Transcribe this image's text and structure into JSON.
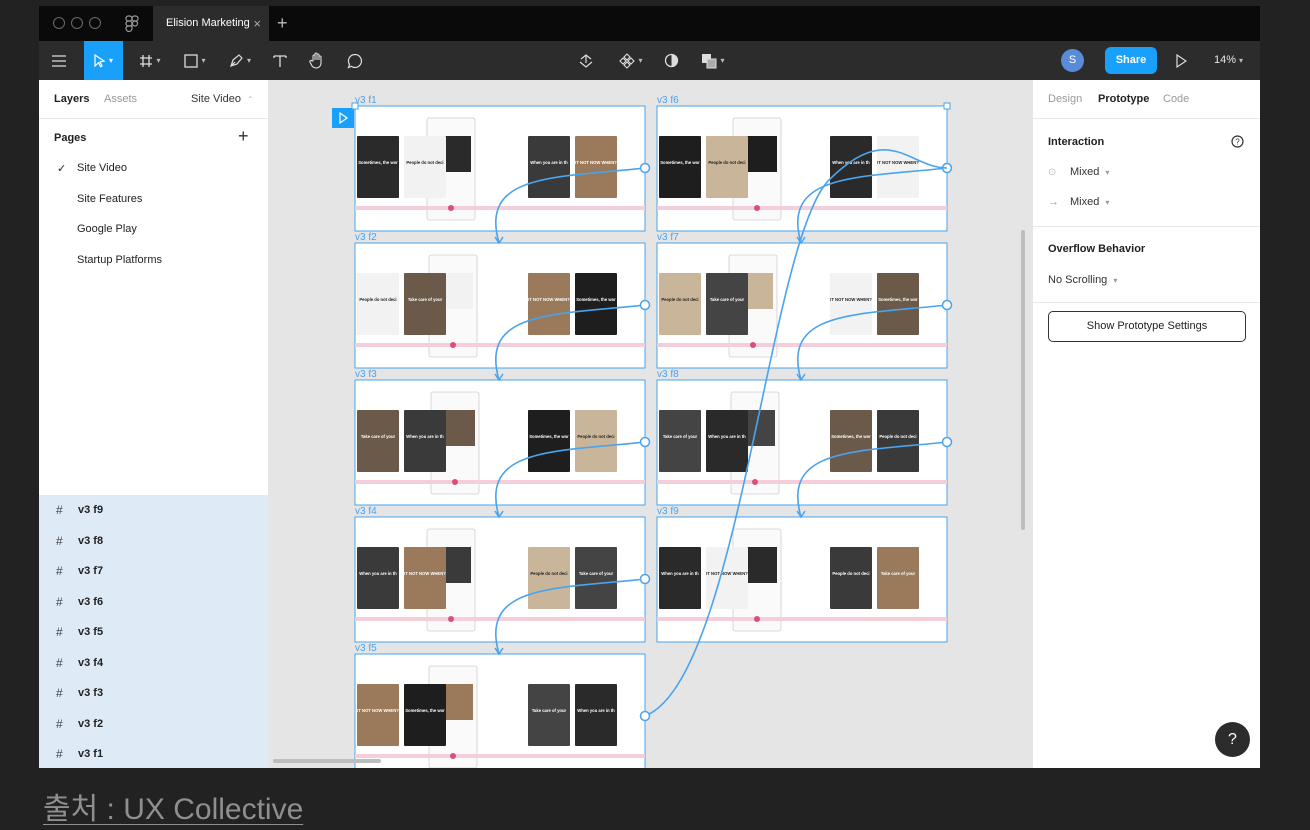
{
  "titlebar": {
    "tab_title": "Elision Marketing",
    "tab_close": "×",
    "new_tab": "+"
  },
  "toolbar": {
    "avatar_initial": "S",
    "share_label": "Share",
    "zoom_level": "14%"
  },
  "left_panel": {
    "tabs": [
      "Layers",
      "Assets"
    ],
    "current_page_selector": "Site Video",
    "pages_heading": "Pages",
    "pages": [
      {
        "label": "Site Video",
        "checked": true
      },
      {
        "label": "Site Features",
        "checked": false
      },
      {
        "label": "Google Play",
        "checked": false
      },
      {
        "label": "Startup Platforms",
        "checked": false
      }
    ],
    "layers": [
      "v3 f9",
      "v3 f8",
      "v3 f7",
      "v3 f6",
      "v3 f5",
      "v3 f4",
      "v3 f3",
      "v3 f2",
      "v3 f1"
    ]
  },
  "canvas": {
    "frames": [
      "v3 f1",
      "v3 f2",
      "v3 f3",
      "v3 f4",
      "v3 f5",
      "v3 f6",
      "v3 f7",
      "v3 f8",
      "v3 f9"
    ],
    "card_texts": [
      "Sometimes, the work you are extremely passionate about is NOT the most important thing.",
      "People do not decide their future, they decide their habits.",
      "Take care of your physical health",
      "When you are in the monotony and it's getting boring, focus in your progress",
      "IT NOT NOW WHEN?"
    ]
  },
  "right_panel": {
    "tabs": [
      "Design",
      "Prototype",
      "Code"
    ],
    "active_tab": "Prototype",
    "interaction_heading": "Interaction",
    "interaction_rows": [
      "Mixed",
      "Mixed"
    ],
    "overflow_heading": "Overflow Behavior",
    "overflow_value": "No Scrolling",
    "settings_button": "Show Prototype Settings",
    "help_label": "?"
  },
  "caption": "출처 : UX Collective",
  "colors": {
    "accent": "#18a0fb",
    "prototype_link": "#4aa3ec",
    "layers_highlight": "#dfeaf7"
  }
}
